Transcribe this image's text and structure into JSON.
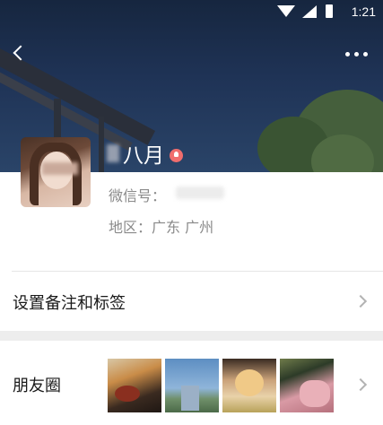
{
  "status_bar": {
    "time": "1:21",
    "wifi_icon": "wifi-icon",
    "signal_icon": "signal-icon",
    "battery_icon": "battery-icon"
  },
  "nav": {
    "back_icon": "back-arrow-icon",
    "more_icon": "more-dots-icon"
  },
  "profile": {
    "nickname": "八月",
    "gender_icon": "female-icon",
    "wechat_id_label": "微信号：",
    "region_label": "地区：",
    "region_value": "广东 广州"
  },
  "rows": {
    "remark_label": "设置备注和标签",
    "moments_label": "朋友圈"
  },
  "colors": {
    "background": "#ffffff",
    "divider": "#ededed",
    "secondary_text": "#8a8a8a",
    "gender_badge": "#f06d6d"
  }
}
